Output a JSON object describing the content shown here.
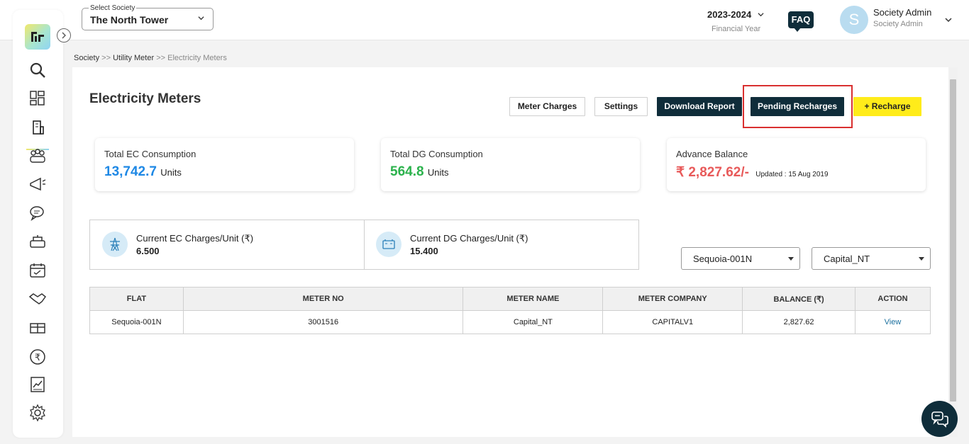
{
  "header": {
    "society_label": "Select Society",
    "society_value": "The North Tower",
    "financial_year": "2023-2024",
    "financial_year_label": "Financial Year",
    "faq_label": "FAQ",
    "avatar_initial": "S",
    "user_name": "Society Admin",
    "user_role": "Society Admin"
  },
  "sidebar": {
    "logo_text": "ᵻᴦ",
    "icons": [
      "search-icon",
      "dashboard-icon",
      "building-icon",
      "people-icon",
      "announcement-icon",
      "chat-icon",
      "amenity-icon",
      "calendar-icon",
      "handshake-icon",
      "parcel-icon",
      "rupee-icon",
      "report-icon",
      "gear-icon"
    ]
  },
  "breadcrumb": {
    "items": [
      "Society",
      "Utility Meter",
      "Electricity Meters"
    ],
    "separator": ">>"
  },
  "page": {
    "title": "Electricity Meters",
    "buttons": {
      "meter_charges": "Meter Charges",
      "settings": "Settings",
      "download_report": "Download Report",
      "pending_recharges": "Pending Recharges",
      "recharge": "+ Recharge"
    }
  },
  "stats": {
    "ec": {
      "title": "Total EC Consumption",
      "value": "13,742.7",
      "unit": "Units",
      "color": "#1e88e5"
    },
    "dg": {
      "title": "Total DG Consumption",
      "value": "564.8",
      "unit": "Units",
      "color": "#2bb24c"
    },
    "advance": {
      "title": "Advance Balance",
      "value": "₹ 2,827.62/-",
      "updated": "Updated : 15 Aug 2019",
      "color": "#e85a5a"
    }
  },
  "charges": {
    "ec": {
      "label": "Current EC Charges/Unit (₹)",
      "value": "6.500"
    },
    "dg": {
      "label": "Current DG Charges/Unit (₹)",
      "value": "15.400"
    }
  },
  "filters": {
    "flat": "Sequoia-001N",
    "meter": "Capital_NT"
  },
  "table": {
    "headers": [
      "FLAT",
      "METER NO",
      "METER NAME",
      "METER COMPANY",
      "BALANCE (₹)",
      "ACTION"
    ],
    "rows": [
      [
        "Sequoia-001N",
        "3001516",
        "Capital_NT",
        "CAPITALV1",
        "2,827.62",
        "View"
      ]
    ]
  }
}
